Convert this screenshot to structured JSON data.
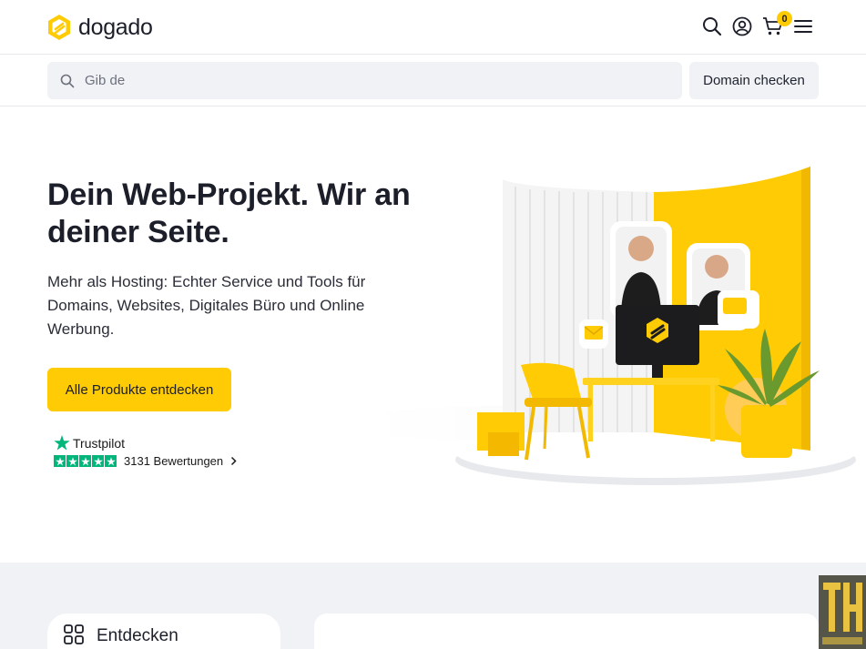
{
  "header": {
    "brand": "dogado",
    "icons": [
      "search-icon",
      "user-icon",
      "cart-icon",
      "menu-icon"
    ],
    "cart_count": "0"
  },
  "search": {
    "placeholder": "Gib de",
    "button_label": "Domain checken"
  },
  "hero": {
    "title": "Dein Web-Projekt. Wir an deiner Seite.",
    "text": "Mehr als Hosting: Echter Service und Tools für Domains, Websites, Digitales Büro und Online Werbung.",
    "cta_label": "Alle Produkte entdecken"
  },
  "trustpilot": {
    "brand": "Trustpilot",
    "reviews": "3131 Bewertungen"
  },
  "sections": {
    "discover_label": "Entdecken"
  },
  "colors": {
    "accent": "#ffcb05",
    "trustpilot_green": "#00b67a",
    "bg_light": "#f0f2f5"
  }
}
